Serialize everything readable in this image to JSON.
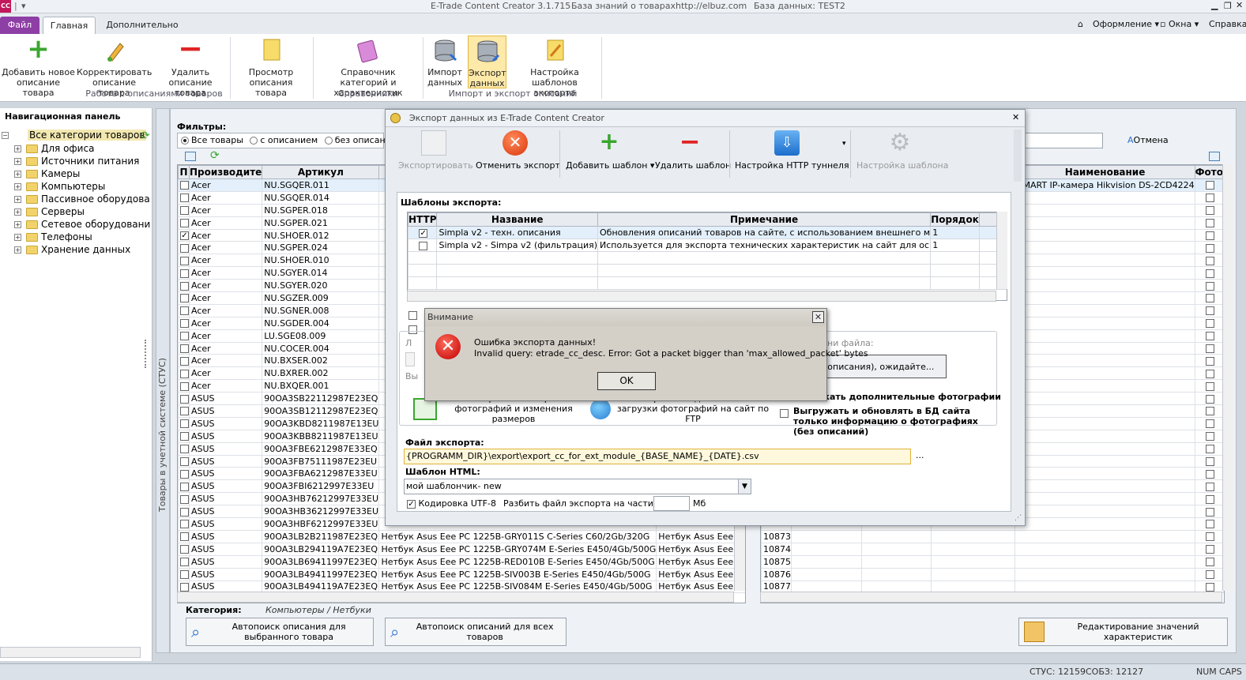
{
  "window": {
    "app_title": "E-Trade Content Creator 3.1.715",
    "kb": "База знаний о товарах",
    "url": "http://elbuz.com",
    "db": "База данных: TEST2",
    "icon_text": "CC"
  },
  "tabs": {
    "file": "Файл",
    "main": "Главная",
    "extra": "Дополнительно"
  },
  "topright": {
    "design": "Оформление",
    "windows": "Окна",
    "help": "Справка"
  },
  "ribbon": {
    "add": "Добавить новое описание товара",
    "edit": "Корректировать описание товара",
    "delete": "Удалить описание товара",
    "view": "Просмотр описания товара",
    "catalog": "Справочник категорий и характеристик",
    "import": "Импорт данных",
    "export": "Экспорт данных",
    "tplsetup": "Настройка шаблонов экспорта",
    "g1": "Работа с описаниями товаров",
    "g2": "Справочники",
    "g3": "Импорт и экспорт описаний"
  },
  "nav": {
    "title": "Навигационная панель",
    "root": "Все категории товаров",
    "items": [
      "Для офиса",
      "Источники питания",
      "Камеры",
      "Компьютеры",
      "Пассивное оборудова",
      "Серверы",
      "Сетевое оборудовани",
      "Телефоны",
      "Хранение данных"
    ]
  },
  "vtab": "Товары в учетной системе (СТУС)",
  "filters": {
    "label": "Фильтры:",
    "all": "Все товары",
    "with": "с описанием",
    "without": "без описания",
    "cancel": "Отмена"
  },
  "grid": {
    "headers": [
      "П",
      "Производите",
      "Артикул"
    ],
    "rows": [
      {
        "chk": false,
        "maker": "Acer",
        "sku": "NU.SGQER.011",
        "name": "",
        "note": ""
      },
      {
        "chk": false,
        "maker": "Acer",
        "sku": "NU.SGQER.014",
        "name": "",
        "note": ""
      },
      {
        "chk": false,
        "maker": "Acer",
        "sku": "NU.SGPER.018",
        "name": "",
        "note": ""
      },
      {
        "chk": false,
        "maker": "Acer",
        "sku": "NU.SGPER.021",
        "name": "",
        "note": ""
      },
      {
        "chk": true,
        "maker": "Acer",
        "sku": "NU.SHOER.012",
        "name": "",
        "note": ""
      },
      {
        "chk": false,
        "maker": "Acer",
        "sku": "NU.SGPER.024",
        "name": "",
        "note": ""
      },
      {
        "chk": false,
        "maker": "Acer",
        "sku": "NU.SHOER.010",
        "name": "",
        "note": ""
      },
      {
        "chk": false,
        "maker": "Acer",
        "sku": "NU.SGYER.014",
        "name": "",
        "note": ""
      },
      {
        "chk": false,
        "maker": "Acer",
        "sku": "NU.SGYER.020",
        "name": "",
        "note": ""
      },
      {
        "chk": false,
        "maker": "Acer",
        "sku": "NU.SGZER.009",
        "name": "",
        "note": ""
      },
      {
        "chk": false,
        "maker": "Acer",
        "sku": "NU.SGNER.008",
        "name": "",
        "note": ""
      },
      {
        "chk": false,
        "maker": "Acer",
        "sku": "NU.SGDER.004",
        "name": "",
        "note": ""
      },
      {
        "chk": false,
        "maker": "Acer",
        "sku": "LU.SGE08.009",
        "name": "",
        "note": ""
      },
      {
        "chk": false,
        "maker": "Acer",
        "sku": "NU.COCER.004",
        "name": "",
        "note": ""
      },
      {
        "chk": false,
        "maker": "Acer",
        "sku": "NU.BXSER.002",
        "name": "",
        "note": ""
      },
      {
        "chk": false,
        "maker": "Acer",
        "sku": "NU.BXRER.002",
        "name": "",
        "note": ""
      },
      {
        "chk": false,
        "maker": "Acer",
        "sku": "NU.BXQER.001",
        "name": "",
        "note": ""
      },
      {
        "chk": false,
        "maker": "ASUS",
        "sku": "90OA3SB22112987E23EQ",
        "name": "",
        "note": ""
      },
      {
        "chk": false,
        "maker": "ASUS",
        "sku": "90OA3SB12112987E23EQ",
        "name": "",
        "note": ""
      },
      {
        "chk": false,
        "maker": "ASUS",
        "sku": "90OA3KBD8211987E13EU",
        "name": "",
        "note": ""
      },
      {
        "chk": false,
        "maker": "ASUS",
        "sku": "90OA3KBB8211987E13EU",
        "name": "",
        "note": ""
      },
      {
        "chk": false,
        "maker": "ASUS",
        "sku": "90OA3FBE6212987E33EQ",
        "name": "",
        "note": ""
      },
      {
        "chk": false,
        "maker": "ASUS",
        "sku": "90OA3FB75111987E23EU",
        "name": "",
        "note": ""
      },
      {
        "chk": false,
        "maker": "ASUS",
        "sku": "90OA3FBA6212987E33EU",
        "name": "",
        "note": ""
      },
      {
        "chk": false,
        "maker": "ASUS",
        "sku": "90OA3FBI6212997E33EU",
        "name": "",
        "note": ""
      },
      {
        "chk": false,
        "maker": "ASUS",
        "sku": "90OA3HB76212997E33EU",
        "name": "",
        "note": ""
      },
      {
        "chk": false,
        "maker": "ASUS",
        "sku": "90OA3HB36212997E33EU",
        "name": "",
        "note": ""
      },
      {
        "chk": false,
        "maker": "ASUS",
        "sku": "90OA3HBF6212997E33EU",
        "name": "",
        "note": ""
      },
      {
        "chk": false,
        "maker": "ASUS",
        "sku": "90OA3LB2B211987E23EQ",
        "name": "Нетбук Asus Eee PC 1225B-GRY011S C-Series C60/2Gb/320G",
        "note": "Нетбук Asus Eee PC 1225B-GR"
      },
      {
        "chk": false,
        "maker": "ASUS",
        "sku": "90OA3LB294119A7E23EQ",
        "name": "Нетбук Asus Eee PC 1225B-GRY074M E-Series E450/4Gb/500G",
        "note": "Нетбук Asus Eee PC 1225B-GR"
      },
      {
        "chk": false,
        "maker": "ASUS",
        "sku": "90OA3LB69411997E23EQ",
        "name": "Нетбук Asus Eee PC 1225B-RED010B E-Series E450/4Gb/500G",
        "note": "Нетбук Asus Eee PC 1225B-RE"
      },
      {
        "chk": false,
        "maker": "ASUS",
        "sku": "90OA3LB49411997E23EQ",
        "name": "Нетбук Asus Eee PC 1225B-SIV003B E-Series E450/4Gb/500G",
        "note": "Нетбук Asus Eee PC 1225B-SI"
      },
      {
        "chk": false,
        "maker": "ASUS",
        "sku": "90OA3LB494119A7E23EQ",
        "name": "Нетбук Asus Eee PC 1225B-SIV084M E-Series E450/4Gb/500G",
        "note": "Нетбук Asus Eee PC 1225B-SI"
      }
    ]
  },
  "grid2": {
    "headers": [
      "Наименование",
      "Фото"
    ],
    "first_name": "SMART IP-камера Hikvision  DS-2CD4224",
    "ids": [
      "10873",
      "10874",
      "10875",
      "10876",
      "10877"
    ]
  },
  "bottom": {
    "category_label": "Категория:",
    "category_value": "Компьютеры / Нетбуки",
    "autosearch_one": "Автопоиск описания для выбранного товара",
    "autosearch_all": "Автопоиск описаний для всех товаров",
    "edit_values": "Редактирование значений характеристик"
  },
  "status": {
    "stus": "СТУС: 12159",
    "sobz": "СОБЗ: 12127",
    "num": "NUM",
    "caps": "CAPS"
  },
  "export": {
    "title": "Экспорт данных из E-Trade Content Creator",
    "btn_export": "Экспортировать",
    "btn_cancel": "Отменить экспорт",
    "btn_add": "Добавить шаблон",
    "btn_delete": "Удалить шаблон",
    "btn_http": "Настройка HTTP туннеля",
    "btn_tplsetup": "Настройка шаблона",
    "templates_label": "Шаблоны экспорта:",
    "tpl_headers": [
      "HTTP",
      "Название",
      "Примечание",
      "Порядок"
    ],
    "templates": [
      {
        "http": true,
        "name": "Simpla v2 - техн. описания",
        "note": "Обновления описаний товаров на сайте, с использованием внешнего м",
        "order": "1"
      },
      {
        "http": false,
        "name": "Simpla v2 - Simpa v2 (фильтрация)",
        "note": "Используется для экспорта технических характеристик на сайт для ос",
        "order": "1"
      }
    ],
    "file_name_hint": "ни файла:",
    "progress_text": "(описания), ожидайте...",
    "photo_cfg": "Настройка экспорта фотографий и изменения размеров",
    "ftp_cfg": "Настройка подключения и загрузки фотографий на сайт по FTP",
    "upload_extra": "жать дополнительные фотографии",
    "upload_only": "Выгружать и обновлять в БД сайта только информацию о фотографиях (без описаний)",
    "file_label": "Файл экспорта:",
    "file_value": "{PROGRAMM_DIR}\\export\\export_cc_for_ext_module_{BASE_NAME}_{DATE}.csv",
    "dots": "...",
    "html_label": "Шаблон HTML:",
    "html_value": "мой шаблончик- new",
    "utf8": "Кодировка UTF-8",
    "split": "Разбить файл экспорта на части, по:",
    "mb": "Мб",
    "left_hint1": "Л",
    "left_hint2": "Вы"
  },
  "alert": {
    "title": "Внимание",
    "line1": "Ошибка экспорта данных!",
    "line2": "Invalid query: etrade_cc_desc. Error: Got a packet bigger than 'max_allowed_packet' bytes",
    "ok": "OK"
  }
}
